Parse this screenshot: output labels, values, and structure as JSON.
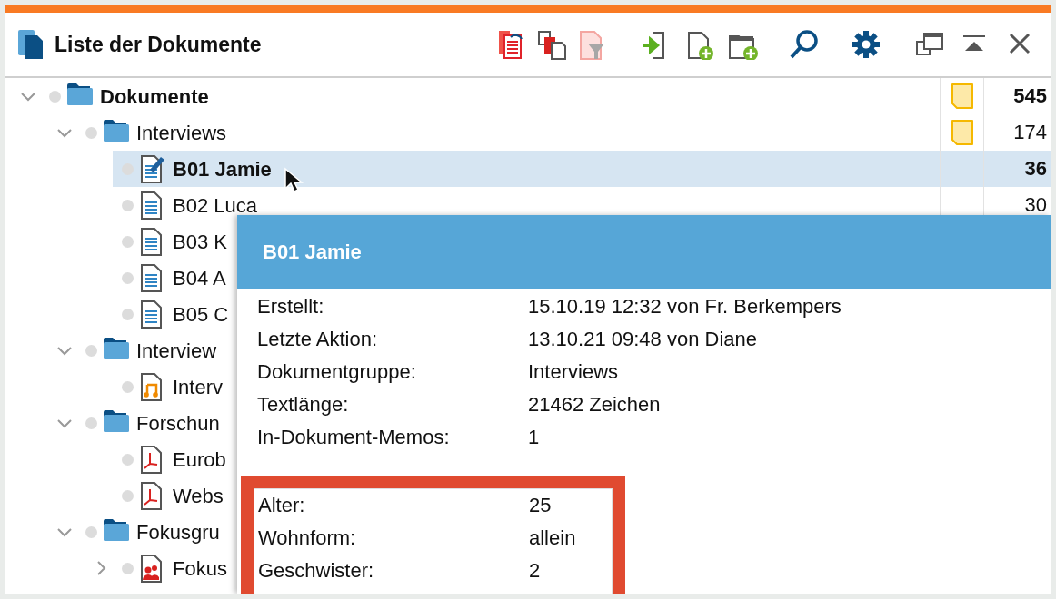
{
  "window": {
    "title": "Liste der Dokumente"
  },
  "tree": [
    {
      "label": "Dokumente",
      "kind": "folder",
      "expanded": true,
      "selected": false,
      "memo": true,
      "count": "545",
      "children": [
        {
          "label": "Interviews",
          "kind": "folder",
          "expanded": true,
          "selected": false,
          "memo": true,
          "count": "174",
          "children": [
            {
              "label": "B01 Jamie",
              "kind": "text-edit",
              "selected": true,
              "memo": false,
              "count": "36"
            },
            {
              "label": "B02 Luca",
              "kind": "text",
              "selected": false,
              "memo": false,
              "count": "30"
            },
            {
              "label": "B03 K",
              "kind": "text",
              "selected": false
            },
            {
              "label": "B04 A",
              "kind": "text",
              "selected": false
            },
            {
              "label": "B05 C",
              "kind": "text",
              "selected": false
            }
          ]
        },
        {
          "label": "Interview",
          "kind": "folder",
          "expanded": true,
          "selected": false,
          "children": [
            {
              "label": "Interv",
              "kind": "audio",
              "selected": false
            }
          ]
        },
        {
          "label": "Forschun",
          "kind": "folder",
          "expanded": true,
          "selected": false,
          "children": [
            {
              "label": "Eurob",
              "kind": "pdf",
              "selected": false
            },
            {
              "label": "Webs",
              "kind": "pdf",
              "selected": false
            }
          ]
        },
        {
          "label": "Fokusgru",
          "kind": "folder",
          "expanded": true,
          "selected": false,
          "children": [
            {
              "label": "Fokus",
              "kind": "focus-group",
              "expanded": false,
              "selected": false
            }
          ]
        }
      ]
    }
  ],
  "popup": {
    "title": "B01 Jamie",
    "info": [
      {
        "label": "Erstellt:",
        "value": "15.10.19 12:32 von Fr. Berkempers"
      },
      {
        "label": "Letzte Aktion:",
        "value": "13.10.21 09:48 von Diane"
      },
      {
        "label": "Dokumentgruppe:",
        "value": "Interviews"
      },
      {
        "label": "Textlänge:",
        "value": "21462 Zeichen"
      },
      {
        "label": "In-Dokument-Memos:",
        "value": "1"
      }
    ],
    "variables": [
      {
        "label": "Alter:",
        "value": "25"
      },
      {
        "label": "Wohnform:",
        "value": "allein"
      },
      {
        "label": "Geschwister:",
        "value": "2"
      }
    ]
  }
}
